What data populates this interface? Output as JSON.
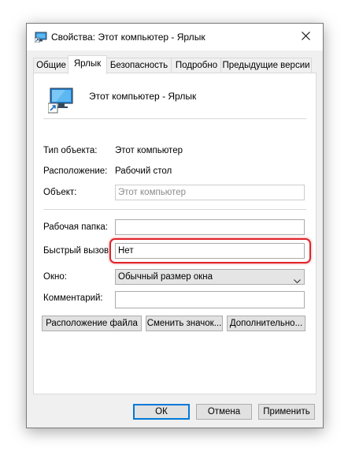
{
  "window": {
    "title": "Свойства: Этот компьютер - Ярлык"
  },
  "tabs": [
    {
      "label": "Общие"
    },
    {
      "label": "Ярлык"
    },
    {
      "label": "Безопасность"
    },
    {
      "label": "Подробно"
    },
    {
      "label": "Предыдущие версии"
    }
  ],
  "header": {
    "name": "Этот компьютер - Ярлык"
  },
  "info": {
    "type_label": "Тип объекта:",
    "type_value": "Этот компьютер",
    "location_label": "Расположение:",
    "location_value": "Рабочий стол",
    "target_label": "Объект:",
    "target_value": "Этот компьютер"
  },
  "form": {
    "workdir_label": "Рабочая папка:",
    "workdir_value": "",
    "hotkey_label": "Быстрый вызов:",
    "hotkey_value": "Нет",
    "run_label": "Окно:",
    "run_value": "Обычный размер окна",
    "comment_label": "Комментарий:",
    "comment_value": ""
  },
  "buttons": {
    "open_location": "Расположение файла",
    "change_icon": "Сменить значок...",
    "advanced": "Дополнительно..."
  },
  "footer": {
    "ok": "ОК",
    "cancel": "Отмена",
    "apply": "Применить"
  },
  "colors": {
    "highlight": "#e0242a",
    "accent": "#0078d7"
  },
  "icons": [
    "shortcut-computer-icon",
    "close-icon",
    "chevron-down-icon"
  ]
}
